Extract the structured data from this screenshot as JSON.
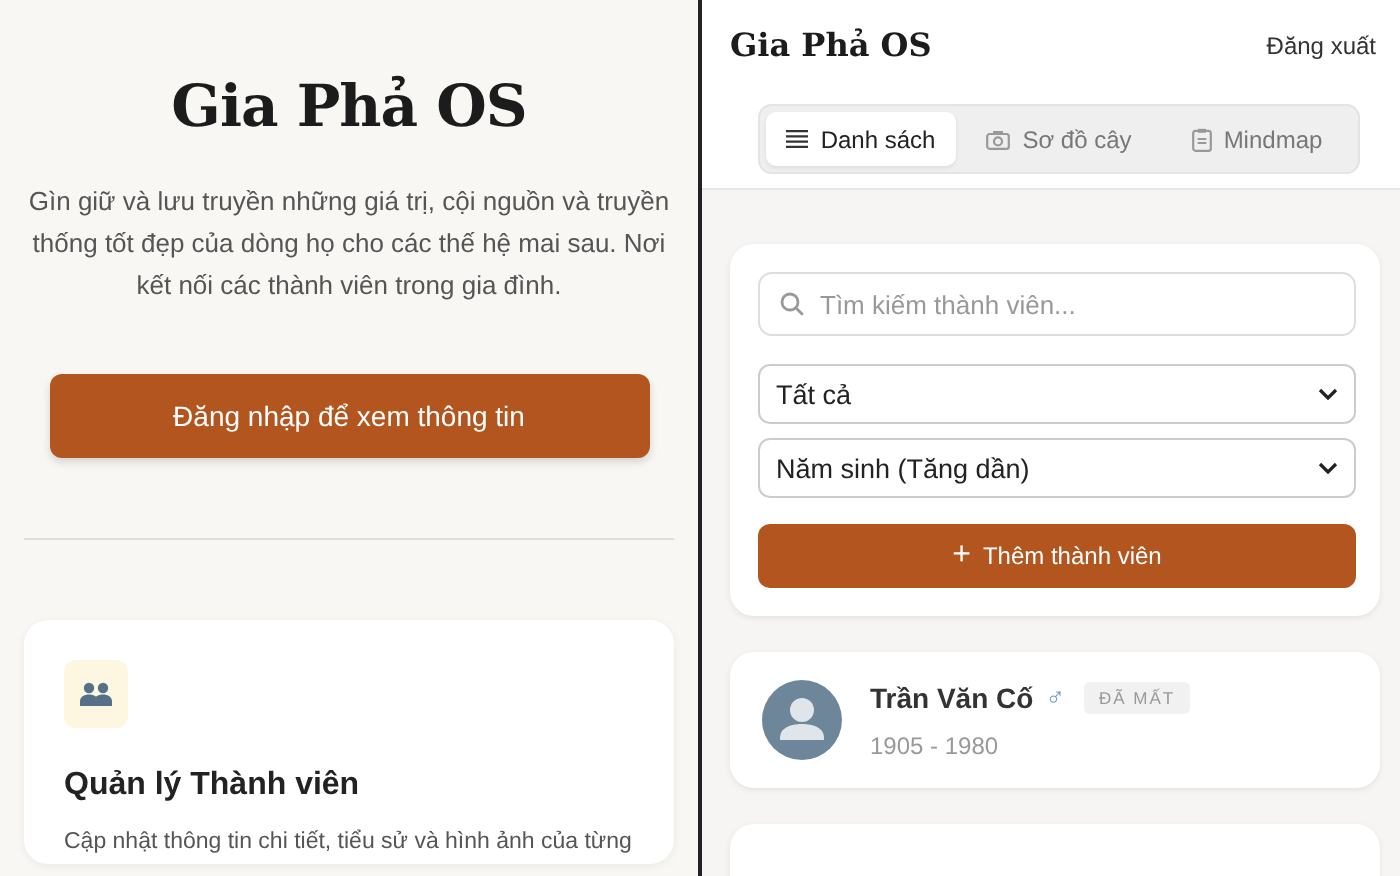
{
  "landing": {
    "title": "Gia Phả OS",
    "description": "Gìn giữ và lưu truyền những giá trị, cội nguồn và truyền thống tốt đẹp của dòng họ cho các thế hệ mai sau. Nơi kết nối các thành viên trong gia đình.",
    "login_button": "Đăng nhập để xem thông tin",
    "feature_card": {
      "title": "Quản lý Thành viên",
      "description": "Cập nhật thông tin chi tiết, tiểu sử và hình ảnh của từng"
    }
  },
  "app": {
    "title": "Gia Phả OS",
    "logout": "Đăng xuất",
    "tabs": [
      {
        "label": "Danh sách",
        "kind": "list",
        "selected": true
      },
      {
        "label": "Sơ đồ cây",
        "kind": "tree",
        "selected": false
      },
      {
        "label": "Mindmap",
        "kind": "mindmap",
        "selected": false
      }
    ],
    "search": {
      "placeholder": "Tìm kiếm thành viên..."
    },
    "filters": [
      {
        "value": "Tất cả"
      },
      {
        "value": "Năm sinh (Tăng dần)"
      }
    ],
    "add_button": {
      "icon": "+",
      "label": "Thêm thành viên"
    },
    "members": [
      {
        "name": "Trần Văn Cố",
        "gender_symbol": "♂",
        "status": "ĐÃ MẤT",
        "years": "1905 - 1980"
      }
    ]
  }
}
